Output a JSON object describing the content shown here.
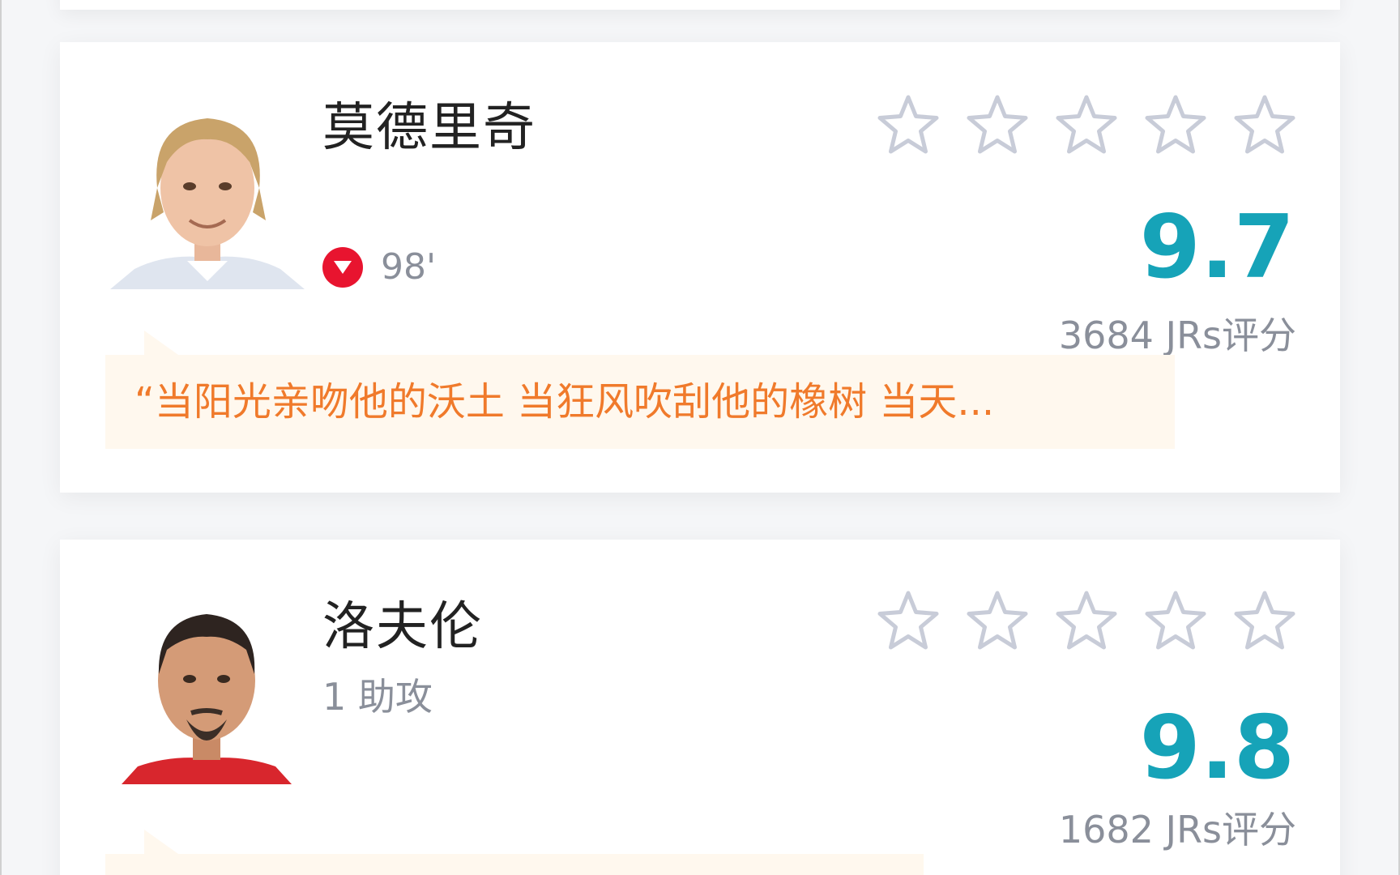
{
  "players": [
    {
      "name": "莫德里奇",
      "event_icon": "substitution-off-icon",
      "event_minute": "98'",
      "stars_filled": 0,
      "stars_total": 5,
      "rating": "9.7",
      "rating_count": "3684 JRs评分",
      "comment": "“当阳光亲吻他的沃土 当狂风吹刮他的橡树 当天...",
      "colors": {
        "rating": "#16a3b8",
        "comment_text": "#f07a2b",
        "comment_bg": "#fff8ee",
        "event_badge": "#e8142f"
      }
    },
    {
      "name": "洛夫伦",
      "stat": "1 助攻",
      "stars_filled": 0,
      "stars_total": 5,
      "rating": "9.8",
      "rating_count": "1682 JRs评分",
      "comment": "",
      "colors": {
        "rating": "#16a3b8",
        "comment_text": "#f07a2b",
        "comment_bg": "#fff8ee"
      }
    }
  ]
}
